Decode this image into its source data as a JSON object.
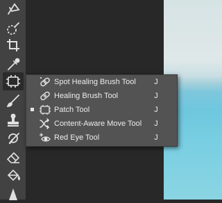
{
  "toolbar": {
    "tools": [
      {
        "name": "lasso-tool",
        "icon": "lasso-icon"
      },
      {
        "name": "quick-selection-tool",
        "icon": "quick-selection-icon"
      },
      {
        "name": "crop-tool",
        "icon": "crop-icon"
      },
      {
        "name": "eyedropper-tool",
        "icon": "eyedropper-icon"
      },
      {
        "name": "patch-tool",
        "icon": "patch-icon",
        "active": true
      },
      {
        "name": "brush-tool",
        "icon": "brush-icon"
      },
      {
        "name": "clone-stamp-tool",
        "icon": "stamp-icon"
      },
      {
        "name": "history-brush-tool",
        "icon": "history-brush-icon"
      },
      {
        "name": "eraser-tool",
        "icon": "eraser-icon"
      },
      {
        "name": "paint-bucket-tool",
        "icon": "bucket-icon"
      },
      {
        "name": "sharpen-tool",
        "icon": "sharpen-icon"
      }
    ]
  },
  "flyout": {
    "items": [
      {
        "label": "Spot Healing Brush Tool",
        "shortcut": "J",
        "icon": "spot-healing-icon",
        "selected": false
      },
      {
        "label": "Healing Brush Tool",
        "shortcut": "J",
        "icon": "bandage-icon",
        "selected": false
      },
      {
        "label": "Patch Tool",
        "shortcut": "J",
        "icon": "patch-icon",
        "selected": true
      },
      {
        "label": "Content-Aware Move Tool",
        "shortcut": "J",
        "icon": "content-aware-move-icon",
        "selected": false
      },
      {
        "label": "Red Eye Tool",
        "shortcut": "J",
        "icon": "red-eye-icon",
        "selected": false
      }
    ]
  }
}
